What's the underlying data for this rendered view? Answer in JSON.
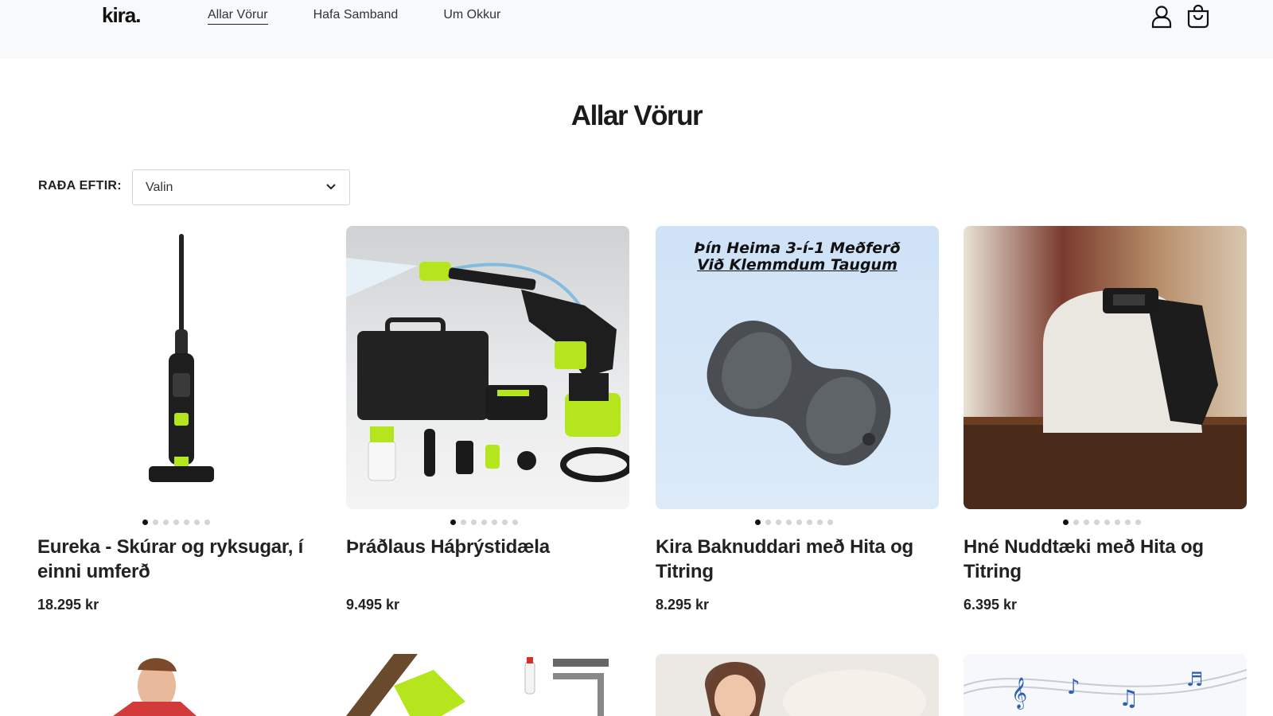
{
  "header": {
    "logo": "kira.",
    "nav": [
      "Allar Vörur",
      "Hafa Samband",
      "Um Okkur"
    ]
  },
  "page": {
    "title": "Allar Vörur"
  },
  "sort": {
    "label": "RAÐA EFTIR:",
    "value": "Valin"
  },
  "products": [
    {
      "title": "Eureka - Skúrar og ryksugar, í einni umferð",
      "price": "18.295 kr",
      "images": 7,
      "active_image": 1
    },
    {
      "title": "Þráðlaus Háþrýstidæla",
      "price": "9.495 kr",
      "images": 7,
      "active_image": 1
    },
    {
      "title": "Kira Baknuddari með Hita og Titring",
      "price": "8.295 kr",
      "image_caption_1": "Þín Heima 3-í-1 Meðferð",
      "image_caption_2": "Við Klemmdum Taugum",
      "images": 8,
      "active_image": 1
    },
    {
      "title": "Hné Nuddtæki með Hita og Titring",
      "price": "6.395 kr",
      "images": 8,
      "active_image": 1
    }
  ],
  "colors": {
    "accent_green": "#b5e61d",
    "header_bg": "#f7f9fb"
  }
}
